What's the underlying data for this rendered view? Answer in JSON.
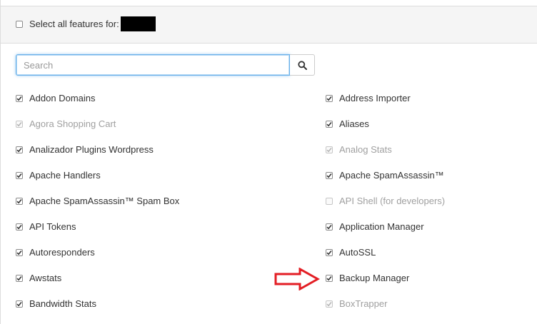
{
  "header": {
    "select_all_label": "Select all features for:",
    "select_all_checked": false
  },
  "search": {
    "placeholder": "Search",
    "value": ""
  },
  "features": [
    {
      "label": "Addon Domains",
      "checked": true,
      "disabled": false
    },
    {
      "label": "Agora Shopping Cart",
      "checked": true,
      "disabled": true
    },
    {
      "label": "Analizador Plugins Wordpress",
      "checked": true,
      "disabled": false
    },
    {
      "label": "Apache Handlers",
      "checked": true,
      "disabled": false
    },
    {
      "label": "Apache SpamAssassin™ Spam Box",
      "checked": true,
      "disabled": false
    },
    {
      "label": "API Tokens",
      "checked": true,
      "disabled": false
    },
    {
      "label": "Autoresponders",
      "checked": true,
      "disabled": false
    },
    {
      "label": "Awstats",
      "checked": true,
      "disabled": false
    },
    {
      "label": "Bandwidth Stats",
      "checked": true,
      "disabled": false
    },
    {
      "label": "Address Importer",
      "checked": true,
      "disabled": false
    },
    {
      "label": "Aliases",
      "checked": true,
      "disabled": false
    },
    {
      "label": "Analog Stats",
      "checked": true,
      "disabled": true
    },
    {
      "label": "Apache SpamAssassin™",
      "checked": true,
      "disabled": false
    },
    {
      "label": "API Shell (for developers)",
      "checked": false,
      "disabled": true
    },
    {
      "label": "Application Manager",
      "checked": true,
      "disabled": false
    },
    {
      "label": "AutoSSL",
      "checked": true,
      "disabled": false
    },
    {
      "label": "Backup Manager",
      "checked": true,
      "disabled": false
    },
    {
      "label": "BoxTrapper",
      "checked": true,
      "disabled": true
    }
  ],
  "colors": {
    "annotation_arrow": "#e31e24",
    "focus_border": "#66afe9"
  },
  "icons": {
    "search_button": "search-icon",
    "annotation": "arrow-right-icon"
  }
}
